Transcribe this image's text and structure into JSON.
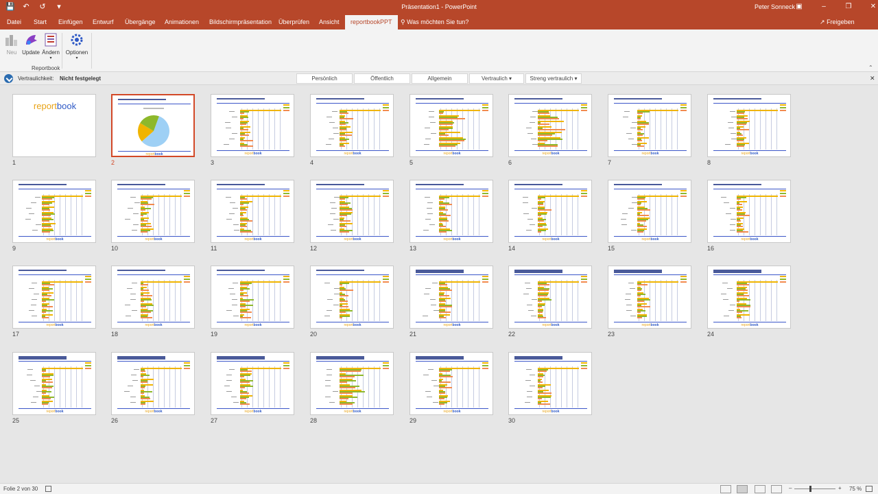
{
  "window": {
    "title": "Präsentation1  -  PowerPoint",
    "user": "Peter Sonneck"
  },
  "tabs": [
    "Datei",
    "Start",
    "Einfügen",
    "Entwurf",
    "Übergänge",
    "Animationen",
    "Bildschirmpräsentation",
    "Überprüfen",
    "Ansicht",
    "reportbookPPT"
  ],
  "active_tab": "reportbookPPT",
  "tell_me": "Was möchten Sie tun?",
  "share": "Freigeben",
  "ribbon": {
    "buttons": {
      "neu": "Neu",
      "update": "Update",
      "aendern": "Ändern",
      "optionen": "Optionen"
    },
    "group": "Reportbook"
  },
  "classification": {
    "label": "Vertraulichkeit:",
    "value": "Nicht festgelegt",
    "buttons": [
      "Persönlich",
      "Öffentlich",
      "Allgemein",
      "Vertraulich",
      "Streng vertraulich"
    ]
  },
  "title_slide": {
    "part1": "report",
    "part2": "book"
  },
  "slide_footer": {
    "part1": "report",
    "part2": "book"
  },
  "slides": [
    1,
    2,
    3,
    4,
    5,
    6,
    7,
    8,
    9,
    10,
    11,
    12,
    13,
    14,
    15,
    16,
    17,
    18,
    19,
    20,
    21,
    22,
    23,
    24,
    25,
    26,
    27,
    28,
    29,
    30
  ],
  "selected_slide": 2,
  "status": {
    "slide_info": "Folie 2 von 30",
    "zoom": "75 %",
    "zoom_level_percent": 75
  },
  "colors": {
    "accent": "#b7472a",
    "series_yellow": "#f0b400",
    "series_green": "#8db82b",
    "series_orange": "#f28a4e",
    "pie_blue": "#9ed0f5"
  }
}
